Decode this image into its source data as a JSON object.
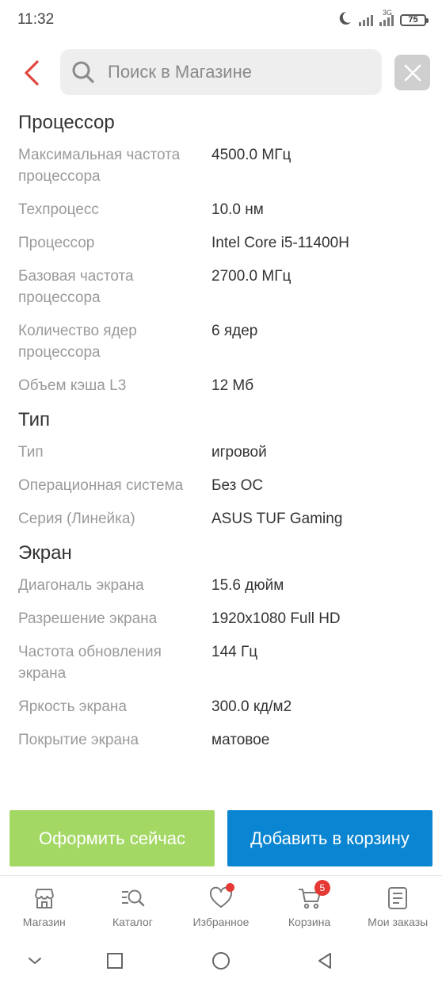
{
  "status_bar": {
    "time": "11:32",
    "network": "3G",
    "battery": "75"
  },
  "search": {
    "placeholder": "Поиск в Магазине",
    "value": ""
  },
  "sections": [
    {
      "title": "Процессор",
      "rows": [
        {
          "label": "Максимальная частота процессора",
          "value": "4500.0 МГц"
        },
        {
          "label": "Техпроцесс",
          "value": "10.0 нм"
        },
        {
          "label": "Процессор",
          "value": "Intel Core i5-11400H"
        },
        {
          "label": "Базовая частота процессора",
          "value": "2700.0 МГц"
        },
        {
          "label": "Количество ядер процессора",
          "value": "6 ядер"
        },
        {
          "label": "Объем кэша L3",
          "value": "12 Мб"
        }
      ]
    },
    {
      "title": "Тип",
      "rows": [
        {
          "label": "Тип",
          "value": "игровой"
        },
        {
          "label": "Операционная система",
          "value": "Без ОС"
        },
        {
          "label": "Серия (Линейка)",
          "value": "ASUS TUF Gaming"
        }
      ]
    },
    {
      "title": "Экран",
      "rows": [
        {
          "label": "Диагональ экрана",
          "value": "15.6 дюйм"
        },
        {
          "label": "Разрешение экрана",
          "value": "1920x1080 Full HD"
        },
        {
          "label": "Частота обновления экрана",
          "value": "144 Гц"
        },
        {
          "label": "Яркость экрана",
          "value": "300.0 кд/м2"
        },
        {
          "label": "Покрытие экрана",
          "value": "матовое"
        }
      ]
    }
  ],
  "actions": {
    "buy_now": "Оформить сейчас",
    "add_to_cart": "Добавить в корзину"
  },
  "bottom_nav": {
    "shop": "Магазин",
    "catalog": "Каталог",
    "favorites": "Избранное",
    "cart": "Корзина",
    "cart_count": "5",
    "orders": "Мои заказы"
  },
  "colors": {
    "accent_red": "#e53935",
    "buy_green": "#a4d864",
    "cart_blue": "#0a85d1"
  }
}
